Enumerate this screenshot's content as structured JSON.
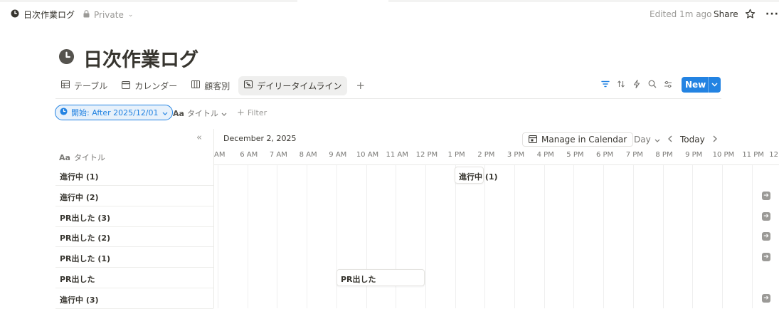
{
  "topbar": {
    "page_name": "日次作業ログ",
    "privacy": "Private",
    "edited": "Edited 1m ago",
    "share_label": "Share"
  },
  "page": {
    "title": "日次作業ログ"
  },
  "views": [
    {
      "label": "テーブル",
      "icon": "table-icon"
    },
    {
      "label": "カレンダー",
      "icon": "calendar-icon"
    },
    {
      "label": "顧客別",
      "icon": "board-icon"
    },
    {
      "label": "デイリータイムライン",
      "icon": "timeline-icon",
      "active": true
    }
  ],
  "toolbar": {
    "new_label": "New"
  },
  "filters": {
    "active_filter": "開始: After 2025/12/01",
    "sort_property": "タイトル",
    "add_filter": "Filter"
  },
  "timeline": {
    "date": "December 2, 2025",
    "manage_label": "Manage in Calendar",
    "scale": "Day",
    "today_label": "Today",
    "column_header": "タイトル",
    "hours": [
      "AM",
      "6 AM",
      "7 AM",
      "8 AM",
      "9 AM",
      "10 AM",
      "11 AM",
      "12 PM",
      "1 PM",
      "2 PM",
      "3 PM",
      "4 PM",
      "5 PM",
      "6 PM",
      "7 PM",
      "8 PM",
      "9 PM",
      "10 PM",
      "11 PM",
      "12"
    ],
    "rows": [
      {
        "title": "進行中 (1)",
        "card": "進行中 (1)",
        "offscreen": false
      },
      {
        "title": "進行中 (2)",
        "card": null,
        "offscreen": true
      },
      {
        "title": "PR出した (3)",
        "card": null,
        "offscreen": true
      },
      {
        "title": "PR出した (2)",
        "card": null,
        "offscreen": true
      },
      {
        "title": "PR出した (1)",
        "card": null,
        "offscreen": true
      },
      {
        "title": "PR出した",
        "card": "PR出した",
        "offscreen": false
      },
      {
        "title": "進行中 (3)",
        "card": null,
        "offscreen": true
      }
    ]
  },
  "colors": {
    "accent": "#2383e2",
    "text": "#37352f",
    "muted": "#9b9a97"
  }
}
